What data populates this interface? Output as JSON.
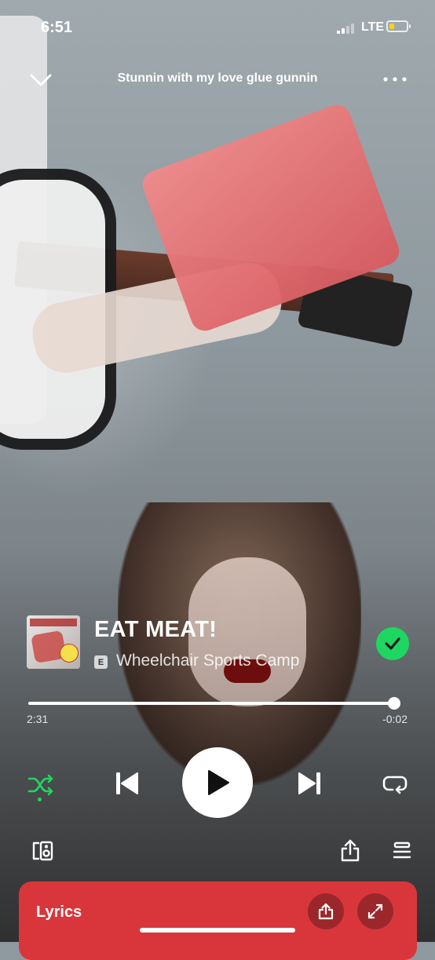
{
  "status_bar": {
    "time": "6:51",
    "network": "LTE",
    "battery_percent": 30
  },
  "header": {
    "title": "Stunnin with my love glue gunnin",
    "collapse_icon": "chevron-down-icon",
    "more_icon": "more-horizontal-icon"
  },
  "track": {
    "title": "EAT MEAT!",
    "explicit_badge": "E",
    "artist": "Wheelchair Sports Camp",
    "liked": true
  },
  "playback": {
    "elapsed": "2:31",
    "remaining": "-0:02",
    "progress_fraction": 0.987,
    "shuffle_on": true,
    "state": "paused"
  },
  "colors": {
    "accent_green": "#1ed760",
    "lyrics_red": "#d9363b",
    "battery_yellow": "#f7d21e"
  },
  "lyrics_card": {
    "label": "Lyrics"
  }
}
